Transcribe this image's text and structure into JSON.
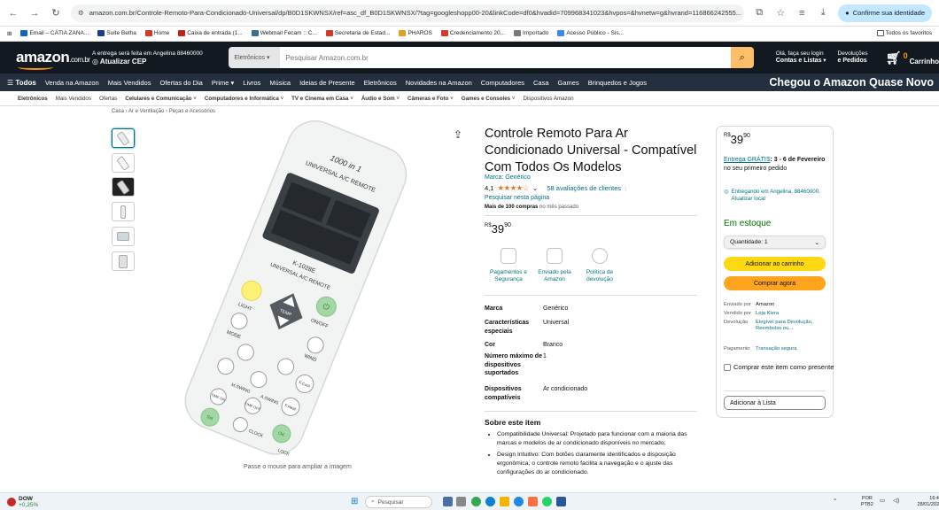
{
  "browser": {
    "url": "amazon.com.br/Controle-Remoto-Para-Condicionado-Universal/dp/B0D1SKWNSX/ref=asc_df_B0D1SKWNSX/?tag=googleshopp00-20&linkCode=df0&hvadid=709968341023&hvpos=&hvnetw=g&hvrand=116866242555...",
    "confirm_label": "Confirme sua identidade",
    "bookmarks": [
      "Email – CÁTIA ZANA...",
      "Suite Betha",
      "Home",
      "Caixa de entrada (1...",
      "Webmail Fecam :: C...",
      "Secretaria de Estad...",
      "PHAROS",
      "Credenciamento 20...",
      "Importado",
      "Acesso Público - Sis..."
    ],
    "bookmarks_right": "Todos os favoritos"
  },
  "header": {
    "logo": "amazon",
    "logo_suffix": ".com.br",
    "deliver_line1": "A entrega será feita em Angelina 88460000",
    "deliver_line2": "Atualizar CEP",
    "search_category": "Eletrônicos",
    "search_placeholder": "Pesquisar Amazon.com.br",
    "account_line1": "Olá, faça seu login",
    "account_line2": "Contas e Listas",
    "orders_line1": "Devoluções",
    "orders_line2": "e Pedidos",
    "cart_count": "0",
    "cart_label": "Carrinho"
  },
  "nav": {
    "todos": "Todos",
    "items": [
      "Venda na Amazon",
      "Mais Vendidos",
      "Ofertas do Dia",
      "Prime",
      "Livros",
      "Música",
      "Ideias de Presente",
      "Eletrônicos",
      "Novidades na Amazon",
      "Computadores",
      "Casa",
      "Games",
      "Brinquedos e Jogos"
    ],
    "promo": "Chegou o Amazon Quase Novo"
  },
  "subnav": [
    "Eletrônicos",
    "Mais Vendidos",
    "Ofertas",
    "Celulares e Comunicação",
    "Computadores e Informática",
    "TV e Cinema em Casa",
    "Áudio e Som",
    "Câmeras e Foto",
    "Games e Consoles",
    "Dispositivos Amazon"
  ],
  "breadcrumb": "Casa › Ar e Ventilação › Peças e Acessórios",
  "gallery": {
    "zoom_hint": "Passe o mouse para ampliar a imagem",
    "remote_labels": {
      "brand": "1000 in 1",
      "top": "UNIVERSAL A/C REMOTE",
      "model": "K-1028E",
      "side": "UNIVERSAL A/C REMOTE",
      "buttons": [
        "ON/OFF",
        "LIGHT",
        "MODE",
        "WIND",
        "TEMP",
        "F.Cool",
        "F.Heat",
        "M.SWING",
        "A.SWING",
        "TIME ON",
        "TIME OFF",
        "CLOCK",
        "OK",
        "LOCK",
        "Set"
      ]
    }
  },
  "product": {
    "title": "Controle Remoto Para Ar Condicionado Universal - Compatível Com Todos Os Modelos",
    "brand": "Marca: Genérico",
    "rating": "4,1",
    "stars": "★★★★☆",
    "reviews": "58 avaliações de clientes",
    "search_page": "Pesquisar nesta página",
    "bought_bold": "Mais de 100 compras",
    "bought_rest": " no mês passado",
    "price_currency": "R$",
    "price_whole": "39",
    "price_cents": "90",
    "features": [
      "Pagamentos e Segurança",
      "Enviado pela Amazon",
      "Política de devolução"
    ],
    "specs": [
      {
        "k": "Marca",
        "v": "Genérico"
      },
      {
        "k": "Características especiais",
        "v": "Universal"
      },
      {
        "k": "Cor",
        "v": "Branco"
      },
      {
        "k": "Número máximo de dispositivos suportados",
        "v": "1"
      },
      {
        "k": "Dispositivos compatíveis",
        "v": "Ar condicionado"
      }
    ],
    "about_title": "Sobre este item",
    "bullets": [
      "Compatibilidade Universal: Projetado para funcionar com a maioria das marcas e modelos de ar condicionado disponíveis no mercado;",
      "Design Intuitivo: Com botões claramente identificados e disposição ergonômica, o controle remoto facilita a navegação e o ajuste das configurações do ar condicionado."
    ]
  },
  "buybox": {
    "delivery_link": "Entrega GRÁTIS",
    "delivery_date": ": 3 - 6 de Fevereiro",
    "delivery_rest": " no seu primeiro pedido",
    "location": "Entregando em Angelina, 88460000. Atualizar local",
    "stock": "Em estoque",
    "quantity": "Quantidade: 1",
    "add_to_cart": "Adicionar ao carrinho",
    "buy_now": "Comprar agora",
    "sellers": [
      {
        "k": "Enviado por",
        "v": "Amazon"
      },
      {
        "k": "Vendido por",
        "v": "Loja Klera"
      },
      {
        "k": "Devolução",
        "v": "Elegível para Devolução, Reembolso ou..."
      },
      {
        "k": "Pagamento",
        "v": "Transação segura"
      }
    ],
    "gift": "Comprar este item como presente",
    "add_list": "Adicionar à Lista"
  },
  "taskbar": {
    "weather_name": "DOW",
    "weather_value": "+0,25%",
    "search": "Pesquisar",
    "lang1": "POR",
    "lang2": "PTB2",
    "time": "16:4",
    "date": "28/01/202"
  },
  "colors": {
    "amazon_dark": "#131921",
    "amazon_nav": "#232f3e",
    "accent": "#ff9900",
    "link": "#007185",
    "stock": "#007600"
  }
}
